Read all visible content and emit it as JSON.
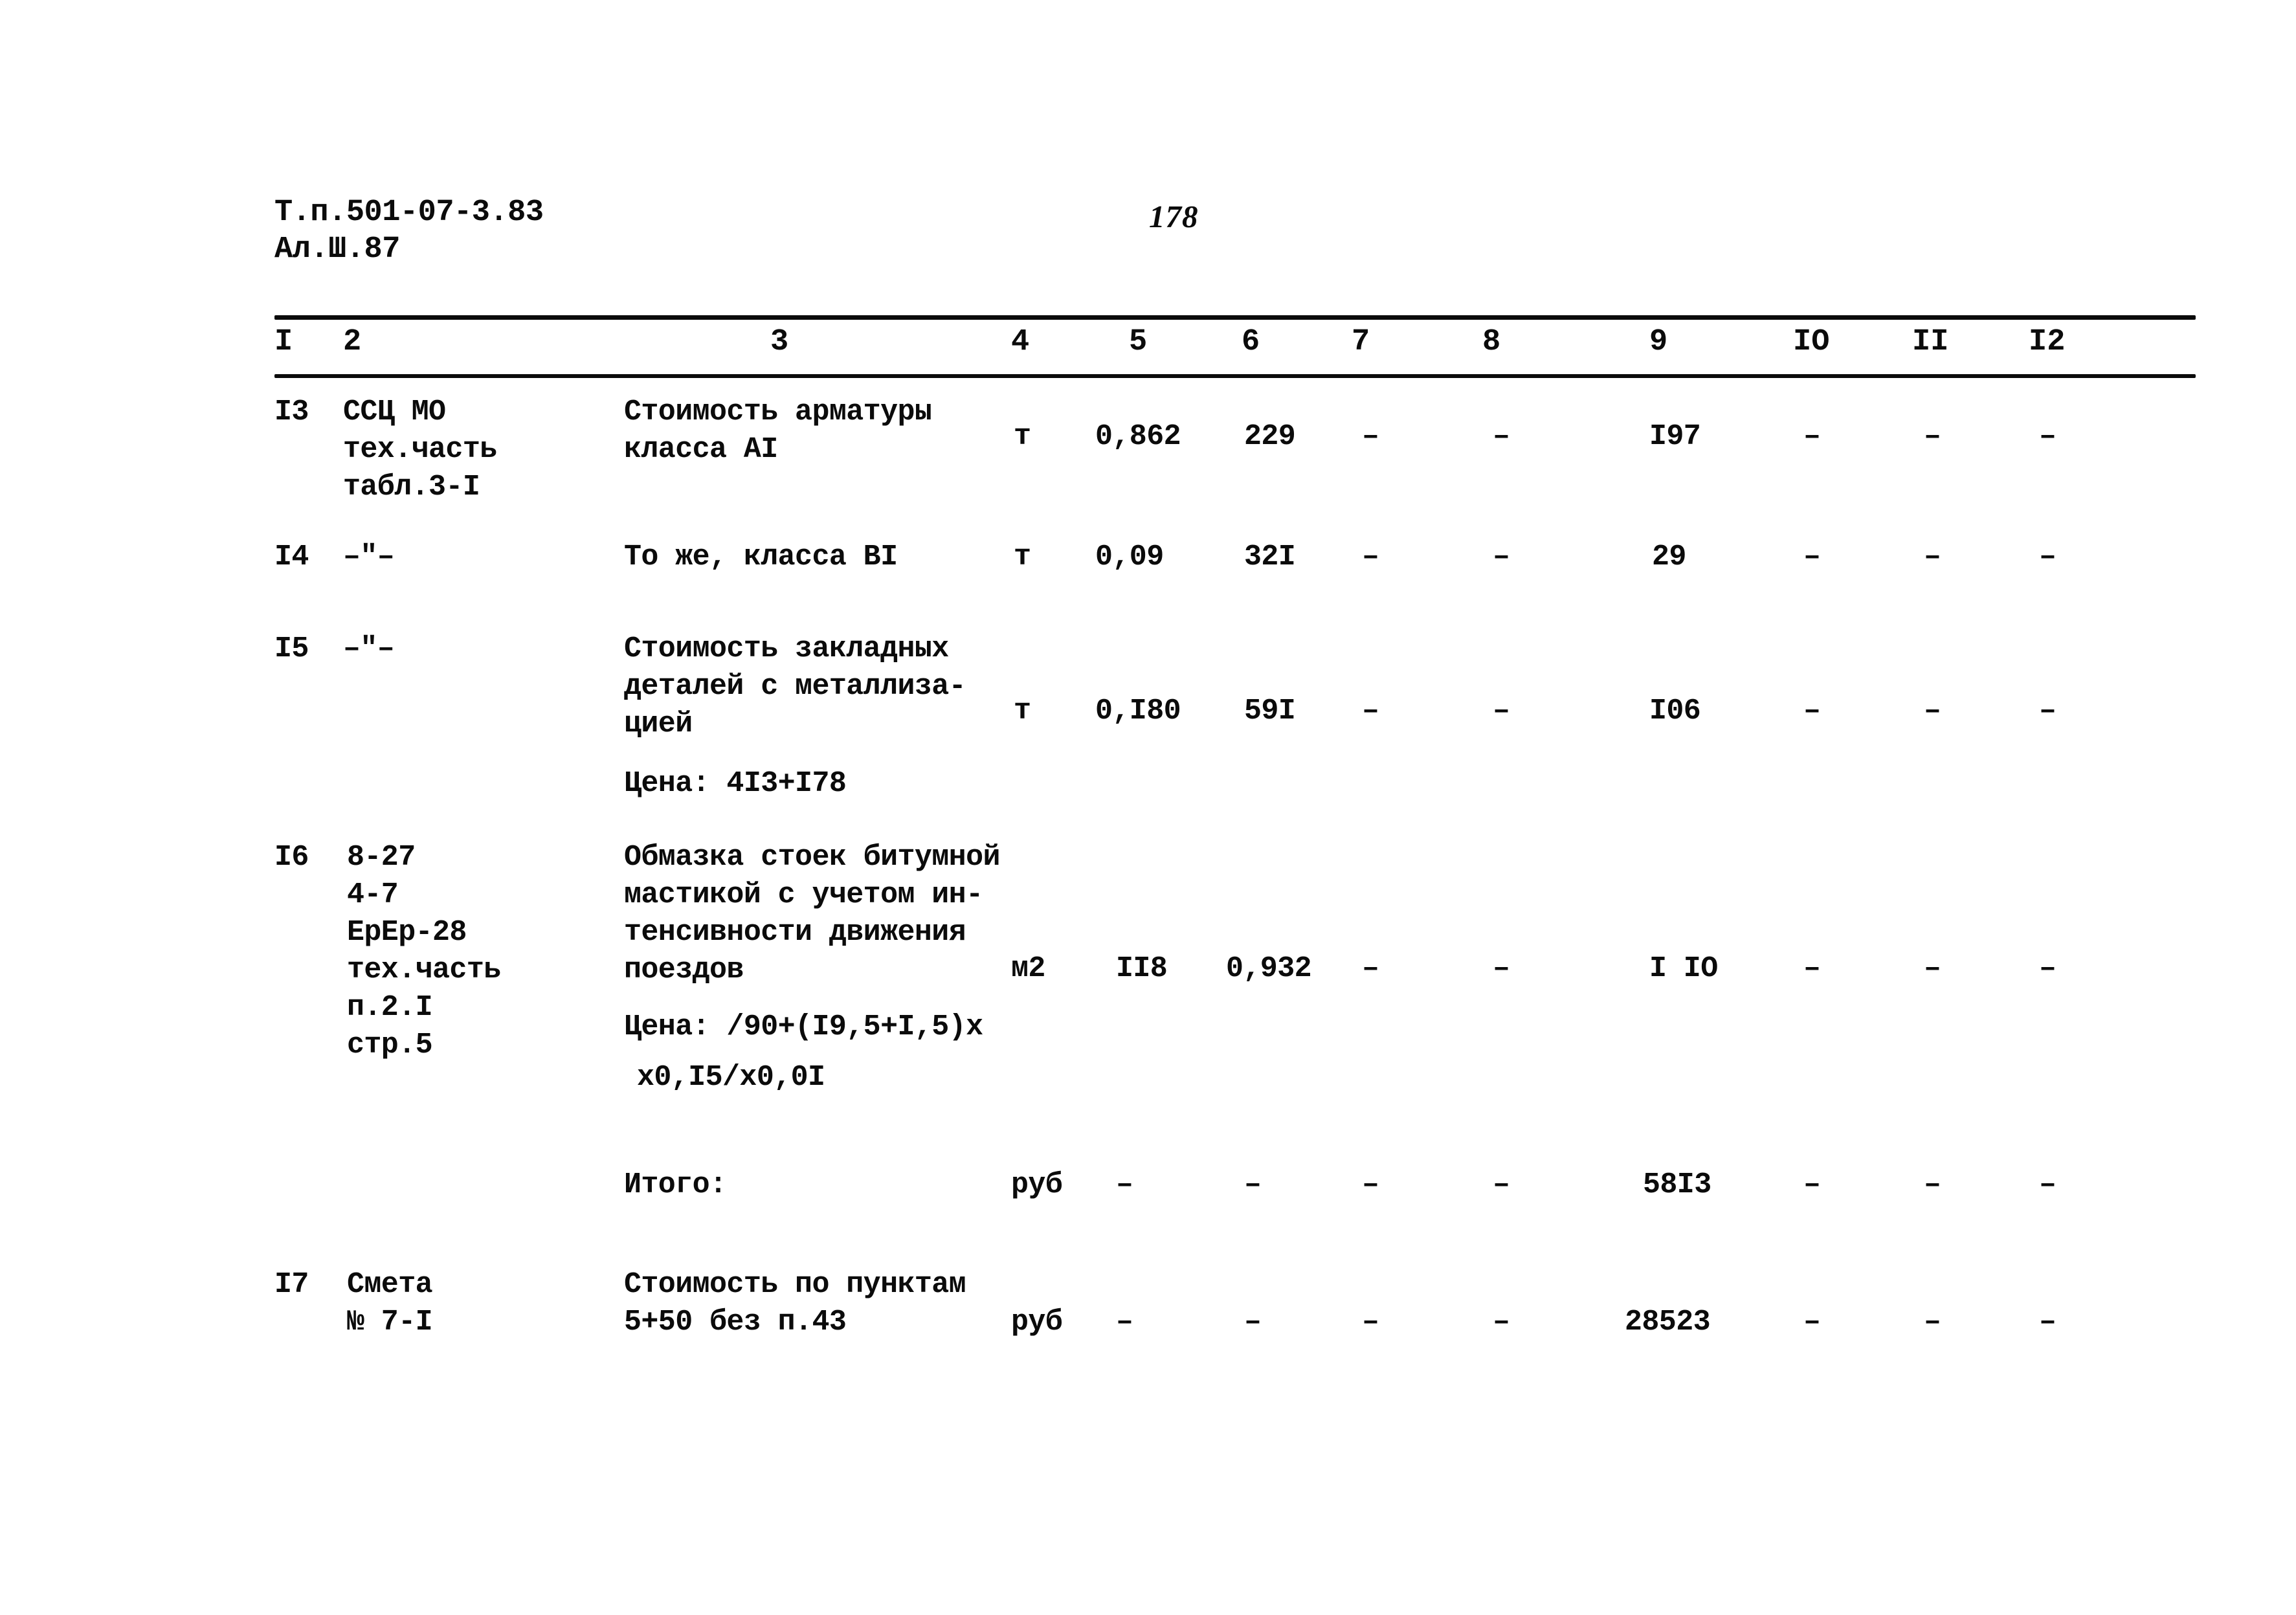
{
  "header": {
    "line1": "Т.п.501-07-3.83",
    "line2": "Ал.Ш.87",
    "page_number": "178"
  },
  "table": {
    "column_headers": [
      "I",
      "2",
      "3",
      "4",
      "5",
      "6",
      "7",
      "8",
      "9",
      "IO",
      "II",
      "I2"
    ],
    "rows": [
      {
        "num": "I3",
        "ref": "ССЦ МО\nтех.часть\nтабл.3-I",
        "desc": "Стоимость арматуры\nкласса АI",
        "unit": "т",
        "c5": "0,862",
        "c6": "229",
        "c7": "–",
        "c8": "–",
        "c9": "I97",
        "c10": "–",
        "c11": "–",
        "c12": "–"
      },
      {
        "num": "I4",
        "ref": "–\"–",
        "desc": "То же, класса ВI",
        "unit": "т",
        "c5": "0,09",
        "c6": "32I",
        "c7": "–",
        "c8": "–",
        "c9": "29",
        "c10": "–",
        "c11": "–",
        "c12": "–"
      },
      {
        "num": "I5",
        "ref": "–\"–",
        "desc": "Стоимость закладных\nдеталей с металлиза-\nцией",
        "note": "Цена: 4I3+I78",
        "unit": "т",
        "c5": "0,I80",
        "c6": "59I",
        "c7": "–",
        "c8": "–",
        "c9": "I06",
        "c10": "–",
        "c11": "–",
        "c12": "–"
      },
      {
        "num": "I6",
        "ref": "8-27\n4-7\nЕрЕр-28\nтех.часть\nп.2.I\nстр.5",
        "desc": "Обмазка стоек битумной\nмастикой с учетом ин-\nтенсивности движения\nпоездов",
        "note1": "Цена: /90+(I9,5+I,5)х",
        "note2": "х0,I5/х0,0I",
        "unit": "м2",
        "c5": "II8",
        "c6": "0,932",
        "c7": "–",
        "c8": "–",
        "c9": "I IO",
        "c10": "–",
        "c11": "–",
        "c12": "–"
      },
      {
        "num": "",
        "ref": "",
        "desc": "Итого:",
        "unit": "руб",
        "c5": "–",
        "c6": "–",
        "c7": "–",
        "c8": "–",
        "c9": "58I3",
        "c10": "–",
        "c11": "–",
        "c12": "–"
      },
      {
        "num": "I7",
        "ref": "Смета\n№ 7-I",
        "desc": "Стоимость по пунктам\n5+50 без п.43",
        "unit": "руб",
        "c5": "–",
        "c6": "–",
        "c7": "–",
        "c8": "–",
        "c9": "28523",
        "c10": "–",
        "c11": "–",
        "c12": "–"
      }
    ]
  }
}
